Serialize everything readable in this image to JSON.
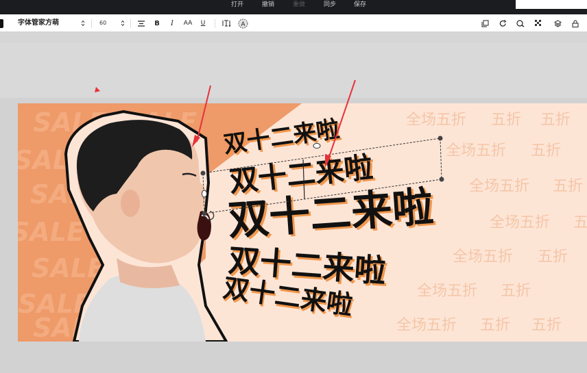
{
  "menu": {
    "open": "打开",
    "undo": "撤销",
    "redo": "重做",
    "sync": "同步",
    "save": "保存"
  },
  "toolbar": {
    "font_name": "字体管家方萌",
    "font_size": "60",
    "icons": [
      "align-icon",
      "bold-icon",
      "italic-icon",
      "case-icon",
      "underline-icon",
      "text-spacing-icon",
      "text-effect-icon",
      "copy-icon",
      "rotate-icon",
      "bucket-icon",
      "transparency-icon",
      "layers-icon",
      "lock-icon"
    ]
  },
  "design": {
    "bg_text": "SALE",
    "discount_texts": [
      "全场五折",
      "五折",
      "五折",
      "全场五折",
      "五折",
      "全场五折",
      "五折",
      "全场五折",
      "五折",
      "全场五折",
      "五折",
      "全场五折",
      "五折",
      "全场五折",
      "五折",
      "五折"
    ],
    "headline": "双十二来啦",
    "colors": {
      "orange": "#ee9a69",
      "cream": "#fde5d6",
      "text_black": "#111111",
      "shadow_orange": "#f0984e",
      "arrow_red": "#e8313a"
    }
  }
}
